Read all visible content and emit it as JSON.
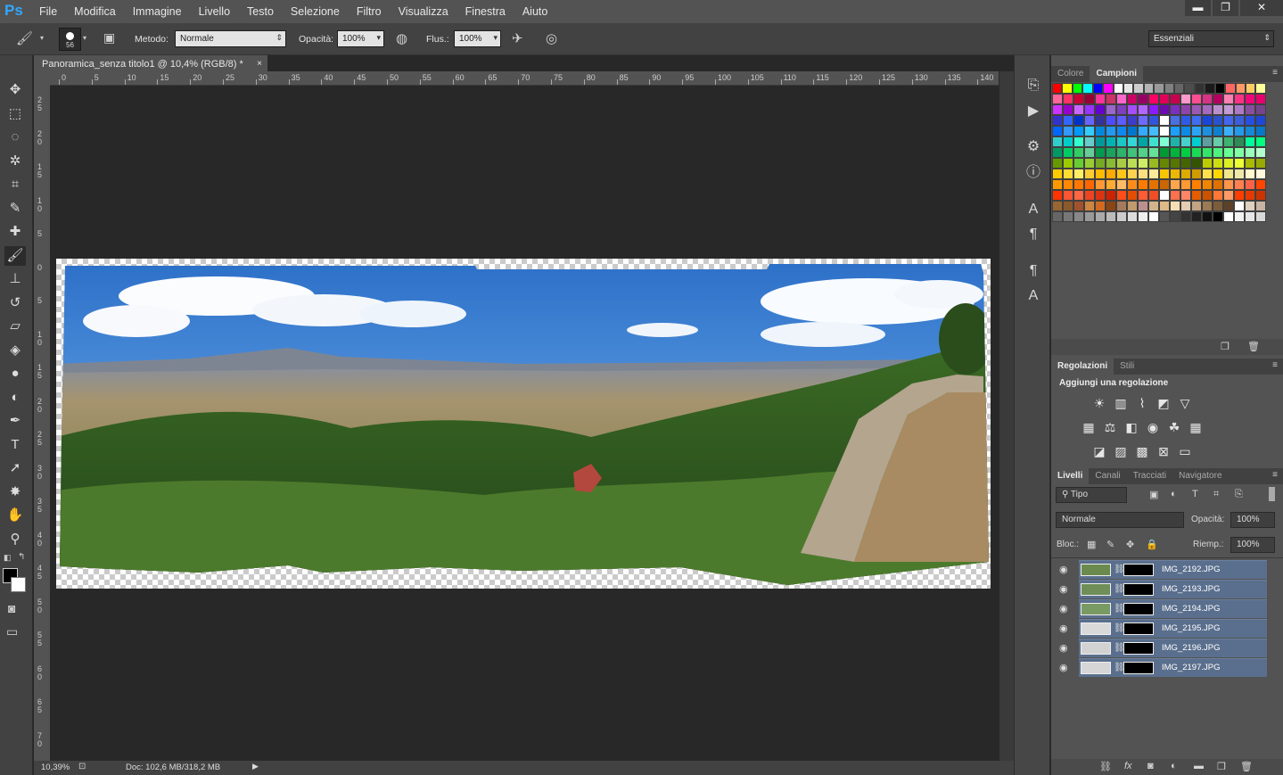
{
  "app": {
    "logo": "Ps"
  },
  "menu": [
    "File",
    "Modifica",
    "Immagine",
    "Livello",
    "Testo",
    "Selezione",
    "Filtro",
    "Visualizza",
    "Finestra",
    "Aiuto"
  ],
  "window_controls": {
    "minimize": "▬",
    "restore": "❐",
    "close": "✕"
  },
  "options": {
    "brush_size": "56",
    "method_label": "Metodo:",
    "method_value": "Normale",
    "opacity_label": "Opacità:",
    "opacity_value": "100%",
    "flow_label": "Flus.:",
    "flow_value": "100%",
    "workspace": "Essenziali"
  },
  "document": {
    "tab_title": "Panoramica_senza titolo1 @ 10,4% (RGB/8) *",
    "zoom": "10,39%",
    "doc_info": "Doc: 102,6 MB/318,2 MB"
  },
  "ruler_top_labels": [
    "0",
    "5",
    "10",
    "15",
    "20",
    "25",
    "30",
    "35",
    "40",
    "45",
    "50",
    "55",
    "60",
    "65",
    "70",
    "75",
    "80",
    "85",
    "90",
    "95",
    "100",
    "105",
    "110",
    "115",
    "120",
    "125",
    "130",
    "135",
    "140"
  ],
  "ruler_left_labels": [
    "2 5",
    "2 0",
    "1 5",
    "1 0",
    "5",
    "0",
    "5",
    "1 0",
    "1 5",
    "2 0",
    "2 5",
    "3 0",
    "3 5",
    "4 0",
    "4 5",
    "5 0",
    "5 5",
    "6 0",
    "6 5",
    "7 0"
  ],
  "tools": [
    {
      "name": "move-tool-icon",
      "glyph": "✥"
    },
    {
      "name": "marquee-tool-icon",
      "glyph": "⬚"
    },
    {
      "name": "lasso-tool-icon",
      "glyph": "◌"
    },
    {
      "name": "magic-wand-icon",
      "glyph": "✲"
    },
    {
      "name": "crop-tool-icon",
      "glyph": "⌗"
    },
    {
      "name": "eyedropper-icon",
      "glyph": "✎"
    },
    {
      "name": "healing-brush-icon",
      "glyph": "✚"
    },
    {
      "name": "brush-tool-icon",
      "glyph": "🖌"
    },
    {
      "name": "clone-stamp-icon",
      "glyph": "⊥"
    },
    {
      "name": "history-brush-icon",
      "glyph": "↺"
    },
    {
      "name": "eraser-icon",
      "glyph": "▱"
    },
    {
      "name": "paint-bucket-icon",
      "glyph": "◈"
    },
    {
      "name": "blur-tool-icon",
      "glyph": "●"
    },
    {
      "name": "dodge-tool-icon",
      "glyph": "◐"
    },
    {
      "name": "pen-tool-icon",
      "glyph": "✒"
    },
    {
      "name": "type-tool-icon",
      "glyph": "T"
    },
    {
      "name": "path-selection-icon",
      "glyph": "➚"
    },
    {
      "name": "custom-shape-icon",
      "glyph": "✸"
    },
    {
      "name": "hand-tool-icon",
      "glyph": "✋"
    },
    {
      "name": "zoom-tool-icon",
      "glyph": "⚲"
    }
  ],
  "color_panel": {
    "tabs": [
      "Colore",
      "Campioni"
    ]
  },
  "swatch_rows": [
    [
      "#ff0000",
      "#ffff00",
      "#00ff00",
      "#00ffff",
      "#0000ff",
      "#ff00ff",
      "#ffffff",
      "#e6e6e6",
      "#cccccc",
      "#b3b3b3",
      "#999999",
      "#808080",
      "#666666",
      "#4d4d4d",
      "#333333",
      "#1a1a1a",
      "#000000",
      "#ff6666",
      "#ff9966",
      "#ffcc66",
      "#ffff99"
    ],
    [
      "#ff6699",
      "#ff3366",
      "#cc0033",
      "#990033",
      "#ff3399",
      "#cc3366",
      "#ff66cc",
      "#cc0066",
      "#990066",
      "#ff0066",
      "#e0005a",
      "#c8004e",
      "#ff99cc",
      "#ff4d94",
      "#d63384",
      "#b3005f",
      "#ff80b3",
      "#ff3385",
      "#f0057a",
      "#e6006e"
    ],
    [
      "#cc33ff",
      "#9900cc",
      "#cc66ff",
      "#9933ff",
      "#6600cc",
      "#9966cc",
      "#7f3fbf",
      "#a64dff",
      "#b366ff",
      "#8c1aff",
      "#6a0dad",
      "#7b2fbe",
      "#8e44ad",
      "#9b59b6",
      "#a569bd",
      "#bb8fce",
      "#c39bd3",
      "#af7ac5",
      "#884ea0",
      "#76448a"
    ],
    [
      "#3333cc",
      "#3366ff",
      "#0033cc",
      "#6666ff",
      "#333399",
      "#4d4dff",
      "#5c5cff",
      "#3d3dcc",
      "#6b6bff",
      "#3355dd",
      "#ffffff",
      "#4a6fe0",
      "#2e5be6",
      "#3f6ff0",
      "#1a46d9",
      "#2952cc",
      "#4466ee",
      "#3a5fd9",
      "#2850e0",
      "#1f47d6"
    ],
    [
      "#0066ff",
      "#3399ff",
      "#0099ff",
      "#33ccff",
      "#0088dd",
      "#2299ee",
      "#1188ee",
      "#0077cc",
      "#33aaff",
      "#44bbff",
      "#ffffff",
      "#1a9fff",
      "#0d8ae6",
      "#2aa5f5",
      "#1b90e0",
      "#0f80d0",
      "#3cb0ff",
      "#2599ea",
      "#1688d8",
      "#0a78c8"
    ],
    [
      "#33cccc",
      "#00cccc",
      "#33ffcc",
      "#66cccc",
      "#009999",
      "#00b3b3",
      "#1ac6c6",
      "#33d6d6",
      "#00a6a6",
      "#40e0d0",
      "#7fffd4",
      "#20b2aa",
      "#48d1cc",
      "#00ced1",
      "#5f9ea0",
      "#66cdaa",
      "#3cb371",
      "#2e8b57",
      "#00fa9a",
      "#00ff7f"
    ],
    [
      "#009966",
      "#00cc66",
      "#33cc66",
      "#66cc99",
      "#00994d",
      "#1aa35c",
      "#2db36b",
      "#40c27a",
      "#53d189",
      "#66e098",
      "#009933",
      "#00b33c",
      "#00cc44",
      "#1ad957",
      "#33e66b",
      "#4df27f",
      "#66ff93",
      "#80ffa6",
      "#99ffba",
      "#b3ffcd"
    ],
    [
      "#669900",
      "#99cc00",
      "#66cc33",
      "#99cc33",
      "#77aa22",
      "#88bb33",
      "#aacc44",
      "#bbdd55",
      "#ccee66",
      "#99bb22",
      "#668800",
      "#557700",
      "#446600",
      "#335500",
      "#bbcc00",
      "#ccdd11",
      "#ddee22",
      "#eeff33",
      "#aabb00",
      "#99aa00"
    ],
    [
      "#ffcc00",
      "#ffdd33",
      "#ffee66",
      "#ffcc33",
      "#ffbb00",
      "#ffaa00",
      "#ffc61a",
      "#ffd24d",
      "#ffdf80",
      "#ffeb99",
      "#f7c600",
      "#eab800",
      "#ddaa00",
      "#d09c00",
      "#ffe14d",
      "#ffd700",
      "#f0e68c",
      "#eee8aa",
      "#fffacd",
      "#fff8dc"
    ],
    [
      "#ff9900",
      "#ff8800",
      "#ff7700",
      "#ff6600",
      "#ff9933",
      "#ffaa33",
      "#ffbb66",
      "#ff8c1a",
      "#ff7b00",
      "#e67300",
      "#cc6600",
      "#ffa64d",
      "#ff9933",
      "#ff8000",
      "#f28500",
      "#e07000",
      "#ff944d",
      "#ff7f50",
      "#ff6347",
      "#ff4500"
    ],
    [
      "#ff3300",
      "#ff5533",
      "#ff6644",
      "#ee4422",
      "#dd3311",
      "#cc2200",
      "#ff4d1a",
      "#e64d00",
      "#ff5c33",
      "#f24d26",
      "#ffffff",
      "#ff704d",
      "#ff8566",
      "#e65c00",
      "#cc5200",
      "#ff7733",
      "#ff9966",
      "#ff3d00",
      "#e63900",
      "#cc3300"
    ],
    [
      "#996633",
      "#8b5a2b",
      "#a0522d",
      "#cd853f",
      "#d2691e",
      "#8b4513",
      "#a67b5b",
      "#c19a6b",
      "#bc8f8f",
      "#d2b48c",
      "#deb887",
      "#f5deb3",
      "#e6ccb3",
      "#c2a383",
      "#9c7a54",
      "#7d5c3a",
      "#5c4027",
      "#ffffff",
      "#e0d0c0",
      "#c8b4a0"
    ],
    [
      "#666666",
      "#777777",
      "#888888",
      "#999999",
      "#aaaaaa",
      "#bbbbbb",
      "#cccccc",
      "#dddddd",
      "#eeeeee",
      "#ffffff",
      "#555555",
      "#444444",
      "#333333",
      "#222222",
      "#111111",
      "#000000",
      "#ffffff",
      "#f2f2f2",
      "#e6e6e6",
      "#d9d9d9"
    ]
  ],
  "adjustments": {
    "tabs": [
      "Regolazioni",
      "Stili"
    ],
    "title": "Aggiungi una regolazione"
  },
  "layers_panel": {
    "tabs": [
      "Livelli",
      "Canali",
      "Tracciati",
      "Navigatore"
    ],
    "filter": "Tipo",
    "blend_mode": "Normale",
    "opacity_label": "Opacità:",
    "opacity_value": "100%",
    "lock_label": "Bloc.:",
    "fill_label": "Riemp.:",
    "fill_value": "100%",
    "layers": [
      "IMG_2192.JPG",
      "IMG_2193.JPG",
      "IMG_2194.JPG",
      "IMG_2195.JPG",
      "IMG_2196.JPG",
      "IMG_2197.JPG"
    ]
  }
}
